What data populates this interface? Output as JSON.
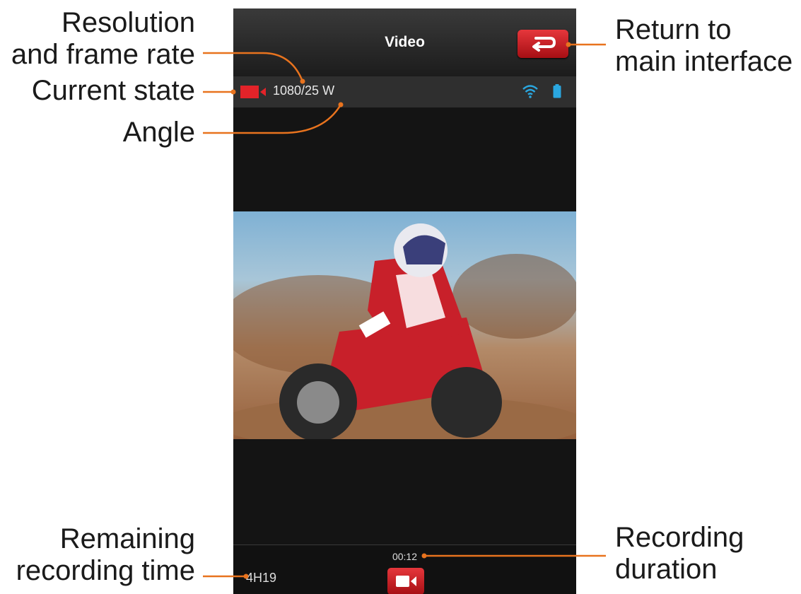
{
  "callouts": {
    "resolution_line1": "Resolution",
    "resolution_line2": "and frame rate",
    "current_state": "Current state",
    "angle": "Angle",
    "return_line1": "Return to",
    "return_line2": "main interface",
    "remaining_line1": "Remaining",
    "remaining_line2": "recording time",
    "duration_line1": "Recording",
    "duration_line2": "duration"
  },
  "header": {
    "title": "Video",
    "return_icon": "return-arrow-icon"
  },
  "status": {
    "resolution_text": "1080/25 W",
    "state_icon": "video-camera-icon",
    "wifi_icon": "wifi-icon",
    "battery_icon": "battery-icon"
  },
  "footer": {
    "duration": "00:12",
    "remaining": "4H19",
    "record_icon": "video-camera-icon"
  },
  "colors": {
    "accent_red": "#d9262b",
    "callout_line": "#e8731e",
    "wifi_blue": "#2aa7e0"
  }
}
